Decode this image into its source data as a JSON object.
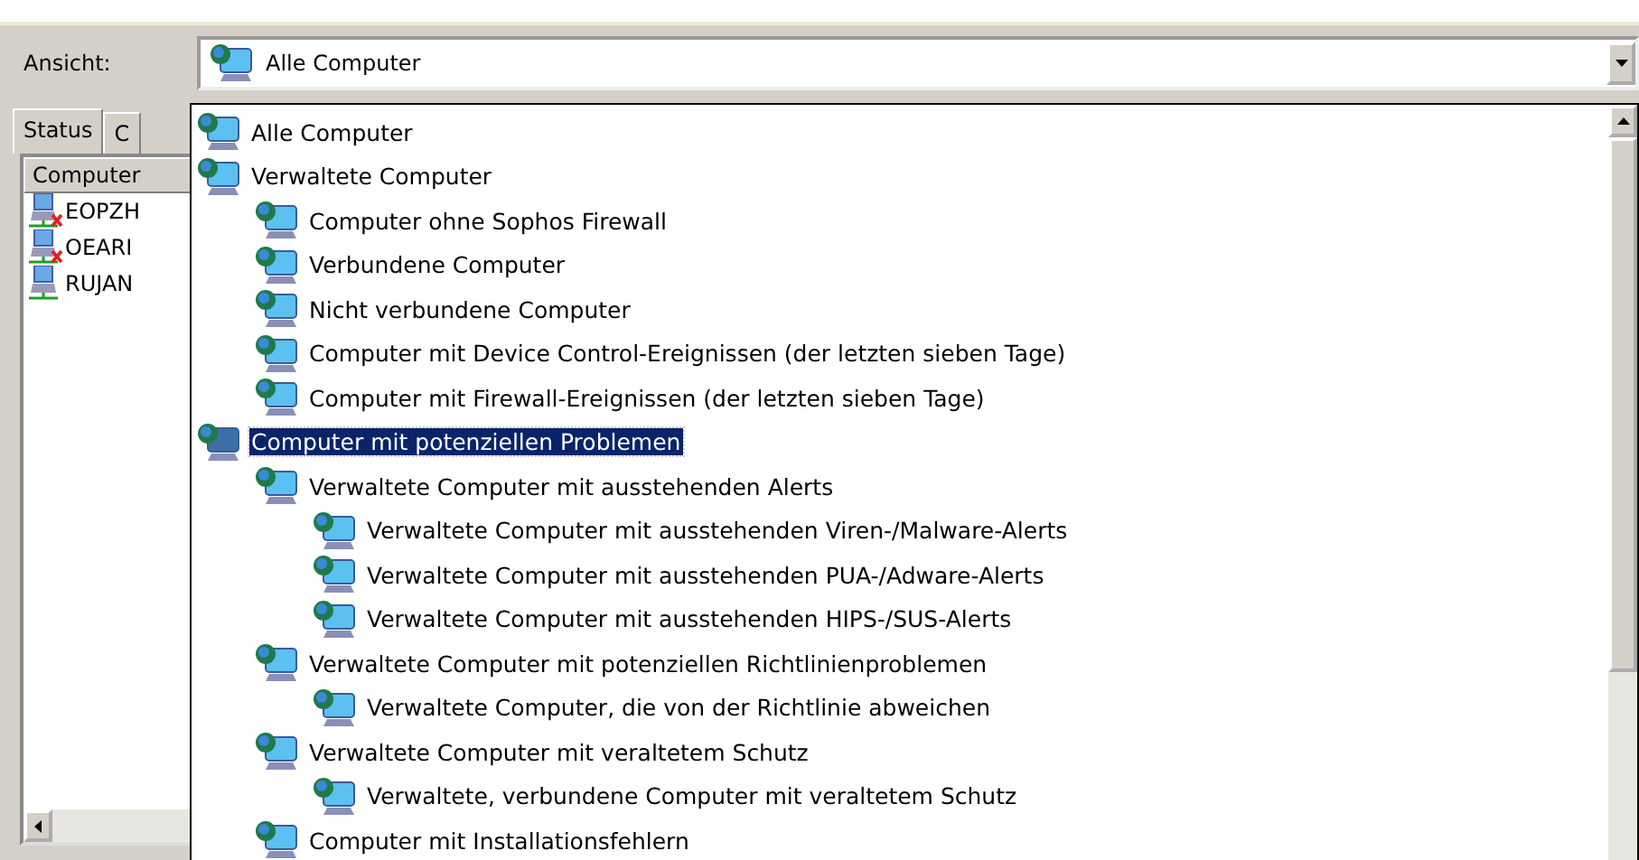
{
  "view": {
    "label": "Ansicht:",
    "value": "Alle Computer"
  },
  "tabs": [
    {
      "label": "Status",
      "selected": true
    },
    {
      "label": "C",
      "selected": false
    }
  ],
  "table": {
    "columns": [
      "Computer"
    ],
    "rows": [
      {
        "name": "EOPZH",
        "error": true
      },
      {
        "name": "OEARI",
        "error": true
      },
      {
        "name": "RUJAN",
        "error": false
      }
    ]
  },
  "dropdown": {
    "items": [
      {
        "label": "Alle Computer",
        "selected": false
      },
      {
        "label": "Verwaltete Computer",
        "selected": false,
        "children": [
          {
            "label": "Computer ohne Sophos Firewall",
            "selected": false
          },
          {
            "label": "Verbundene Computer",
            "selected": false
          },
          {
            "label": "Nicht verbundene Computer",
            "selected": false
          },
          {
            "label": "Computer mit Device Control-Ereignissen (der letzten sieben Tage)",
            "selected": false
          },
          {
            "label": "Computer mit Firewall-Ereignissen (der letzten sieben Tage)",
            "selected": false
          }
        ]
      },
      {
        "label": "Computer mit potenziellen Problemen",
        "selected": true,
        "children": [
          {
            "label": "Verwaltete Computer mit ausstehenden Alerts",
            "selected": false,
            "children": [
              {
                "label": "Verwaltete Computer mit ausstehenden Viren-/Malware-Alerts",
                "selected": false
              },
              {
                "label": "Verwaltete Computer mit ausstehenden PUA-/Adware-Alerts",
                "selected": false
              },
              {
                "label": "Verwaltete Computer mit ausstehenden HIPS-/SUS-Alerts",
                "selected": false
              }
            ]
          },
          {
            "label": "Verwaltete Computer mit potenziellen Richtlinienproblemen",
            "selected": false,
            "children": [
              {
                "label": "Verwaltete Computer, die von der Richtlinie abweichen",
                "selected": false
              }
            ]
          },
          {
            "label": "Verwaltete Computer mit veraltetem Schutz",
            "selected": false,
            "children": [
              {
                "label": "Verwaltete, verbundene Computer mit veraltetem Schutz",
                "selected": false
              }
            ]
          },
          {
            "label": "Computer mit Installationsfehlern",
            "selected": false
          }
        ]
      }
    ]
  }
}
